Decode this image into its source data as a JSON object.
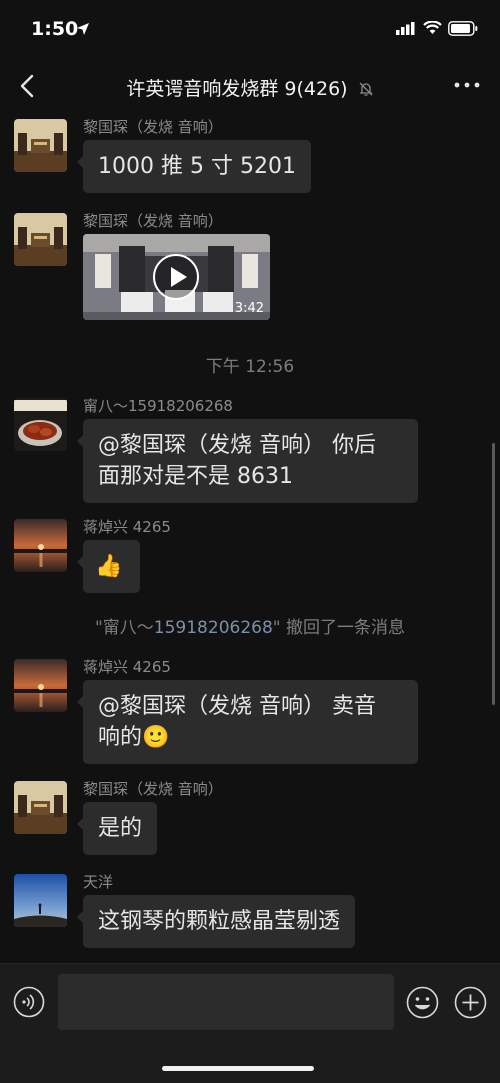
{
  "status": {
    "time": "1:50"
  },
  "header": {
    "title": "许英谔音响发烧群 9(426)"
  },
  "messages": [
    {
      "type": "text",
      "sender": "黎国琛（发烧 音响）",
      "avatar": "speaker-room-avatar",
      "lines": [
        "1000 推 5 寸 5201"
      ]
    },
    {
      "type": "video",
      "sender": "黎国琛（发烧 音响）",
      "avatar": "speaker-room-avatar",
      "duration": "3:42"
    },
    {
      "type": "time",
      "text": "下午 12:56"
    },
    {
      "type": "text",
      "sender": "甯八～15918206268",
      "avatar": "food-plate-avatar",
      "lines": [
        "@黎国琛（发烧 音响） 你后",
        "面那对是不是 8631"
      ]
    },
    {
      "type": "emoji",
      "sender": "蒋焯兴 4265",
      "avatar": "sunset-avatar",
      "emoji": "👍"
    },
    {
      "type": "recall",
      "name": "15918206268",
      "prefix": "\"甯八～",
      "suffix": "\" 撤回了一条消息"
    },
    {
      "type": "text",
      "sender": "蒋焯兴 4265",
      "avatar": "sunset-avatar",
      "lines": [
        "@黎国琛（发烧 音响） 卖音",
        "响的🙂"
      ]
    },
    {
      "type": "text",
      "sender": "黎国琛（发烧 音响）",
      "avatar": "speaker-room-avatar",
      "lines": [
        "是的"
      ]
    },
    {
      "type": "text",
      "sender": "天洋",
      "avatar": "sky-silhouette-avatar",
      "lines": [
        "这钢琴的颗粒感晶莹剔透"
      ]
    }
  ],
  "input": {
    "placeholder": ""
  },
  "icons": {
    "back": "chevron-left-icon",
    "mute": "bell-slash-icon",
    "more": "ellipsis-icon",
    "voice": "voice-icon",
    "emoji": "smiley-icon",
    "plus": "plus-circle-icon"
  },
  "colors": {
    "background": "#111111",
    "bubble": "#2c2c2c",
    "name": "#8a8a8a",
    "link": "#7d90a9"
  }
}
